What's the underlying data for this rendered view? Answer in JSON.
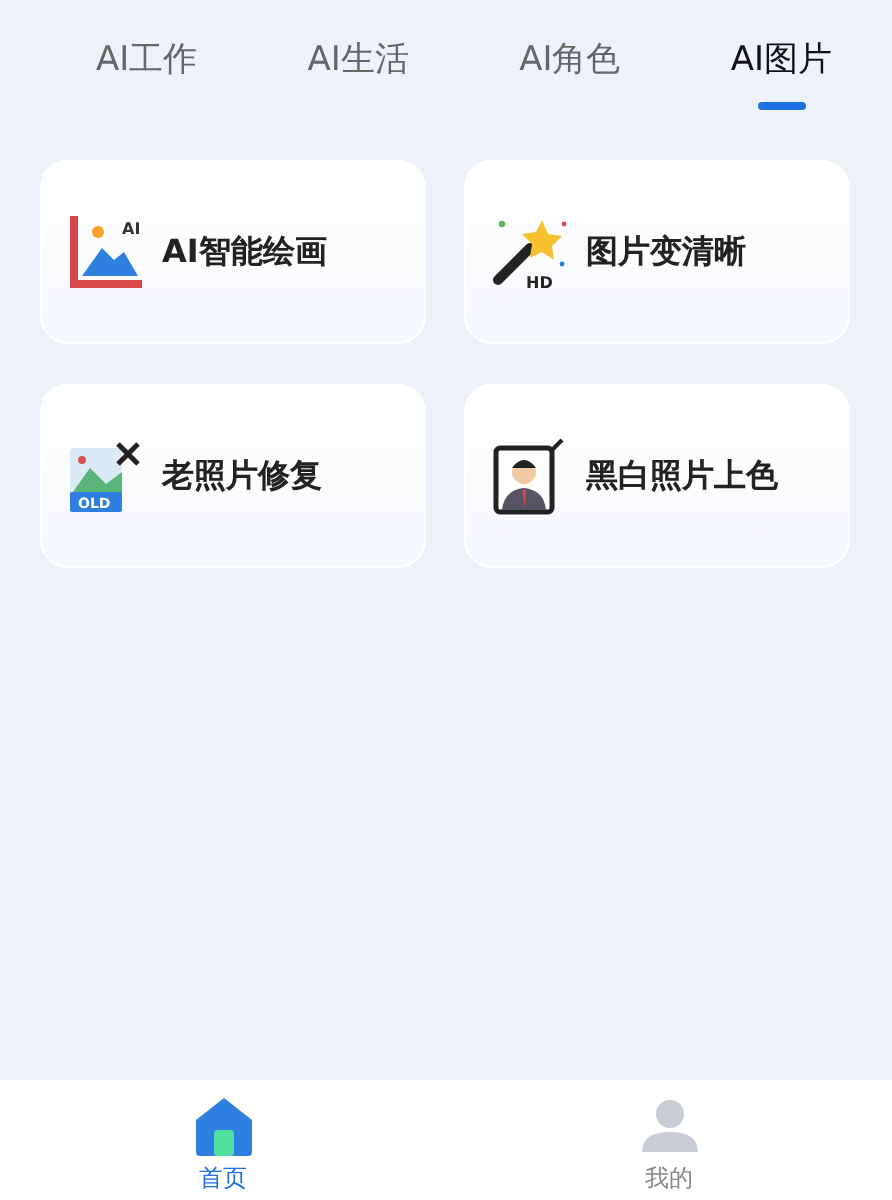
{
  "tabs": [
    {
      "label": "AI工作",
      "selected": false
    },
    {
      "label": "AI生活",
      "selected": false
    },
    {
      "label": "AI角色",
      "selected": false
    },
    {
      "label": "AI图片",
      "selected": true
    }
  ],
  "cards": [
    {
      "kind": "painting",
      "label": "AI智能绘画",
      "icon_text": "AI"
    },
    {
      "kind": "enhance",
      "label": "图片变清晰",
      "icon_text": "HD"
    },
    {
      "kind": "restore",
      "label": "老照片修复",
      "icon_text": "OLD"
    },
    {
      "kind": "colorize",
      "label": "黑白照片上色"
    }
  ],
  "bottom_nav": [
    {
      "kind": "home",
      "label": "首页",
      "selected": true
    },
    {
      "kind": "profile",
      "label": "我的",
      "selected": false
    }
  ]
}
